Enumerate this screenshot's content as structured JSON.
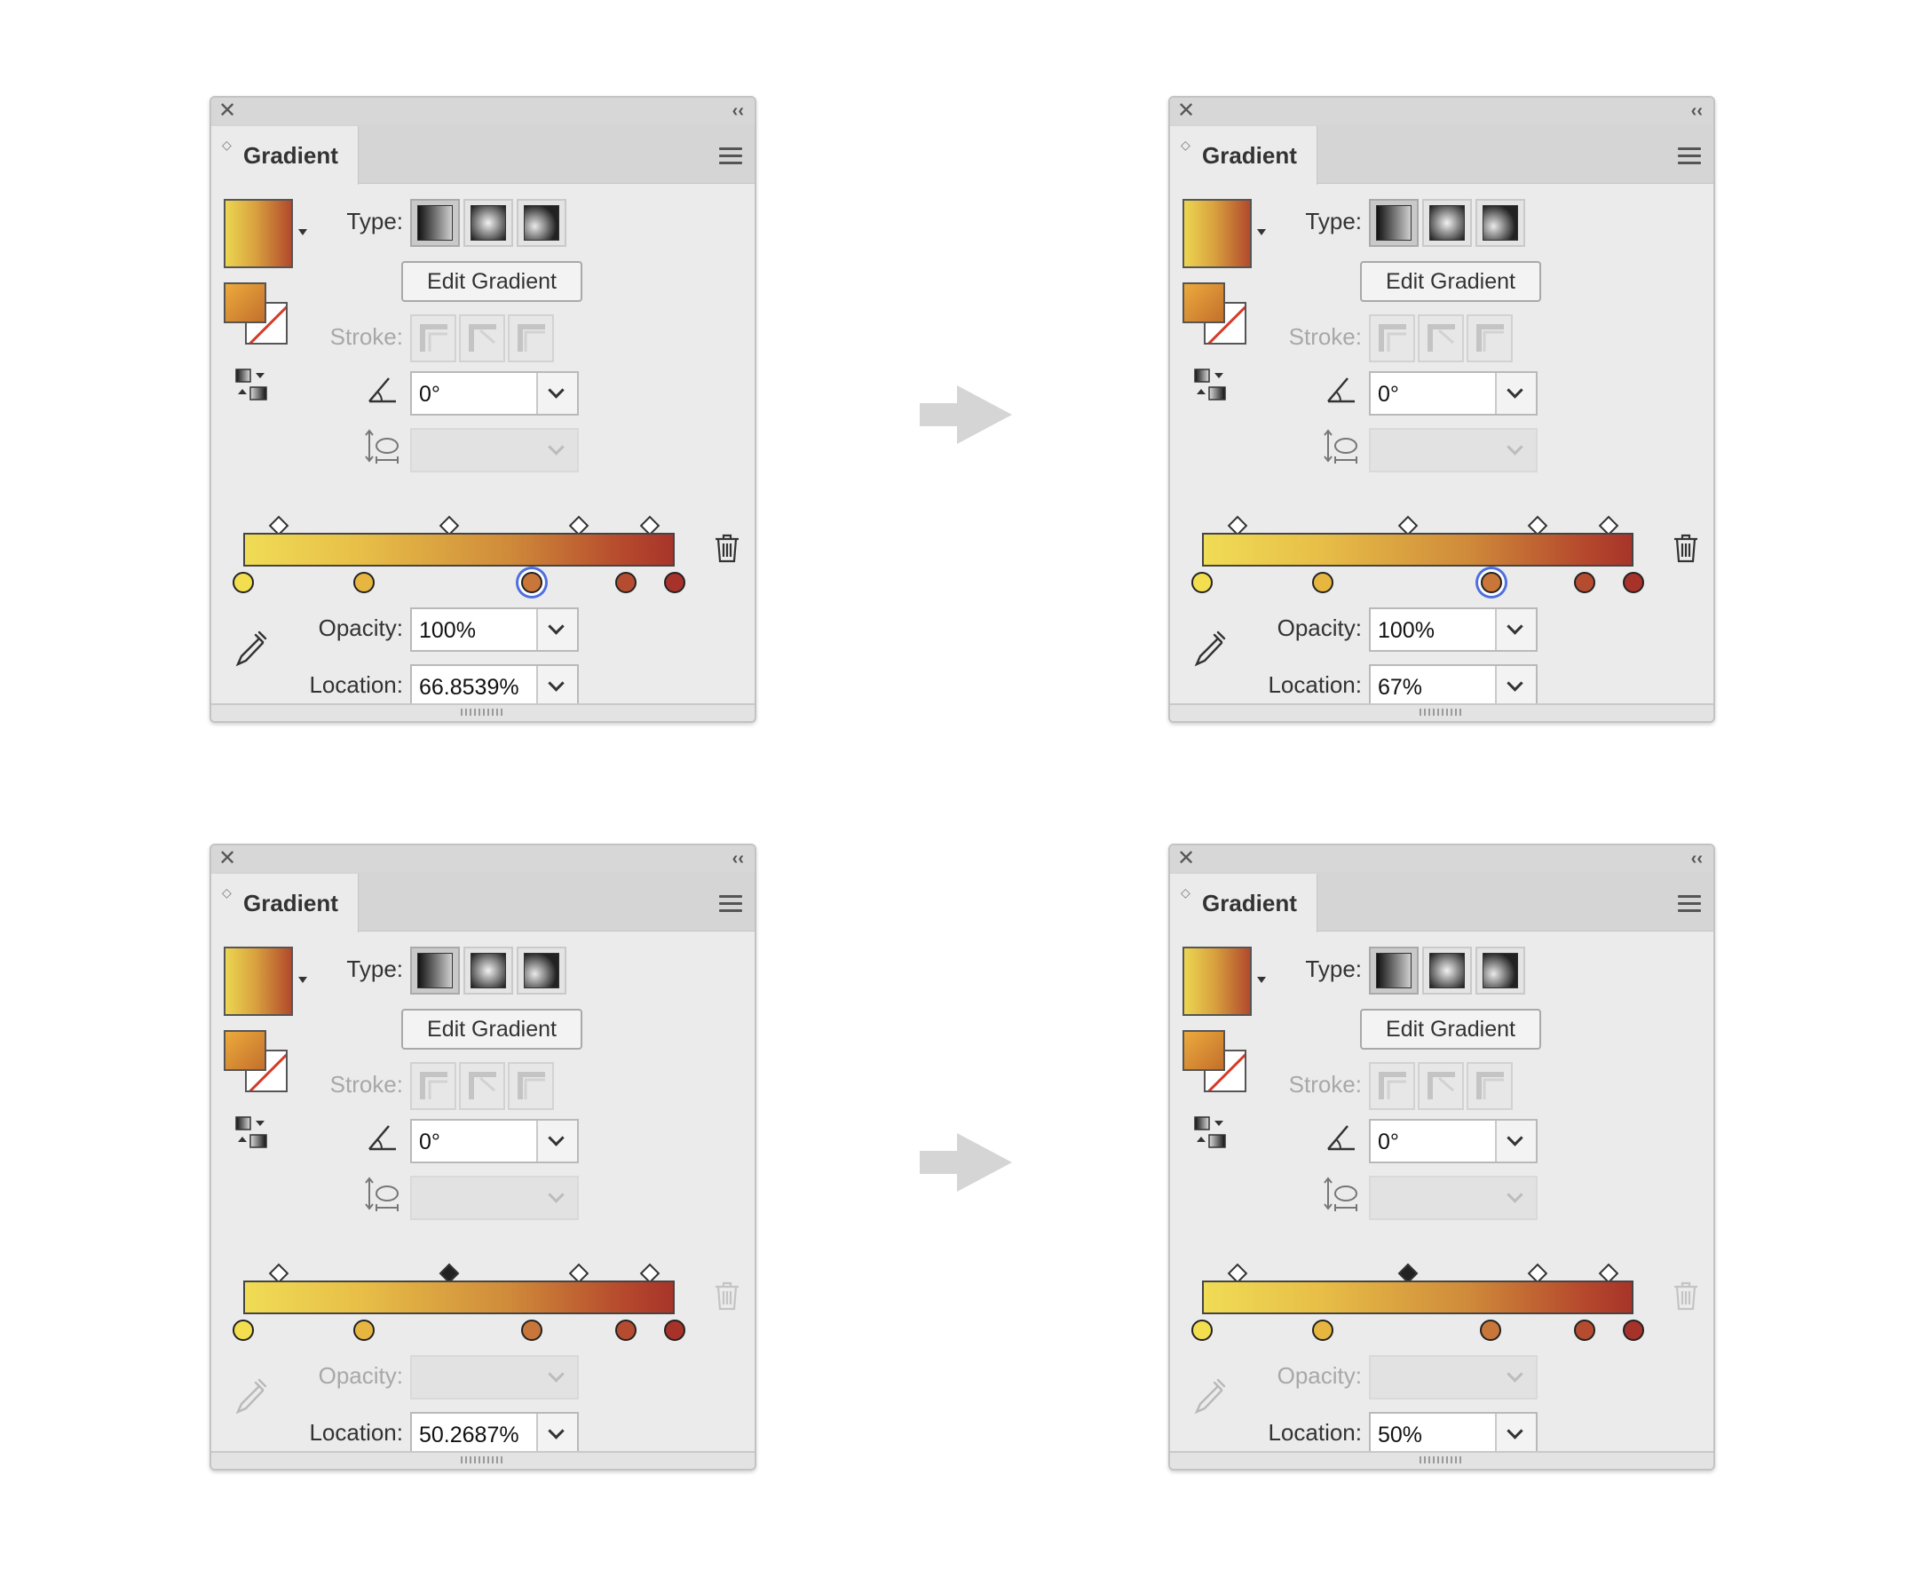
{
  "colors": {
    "panel_bg": "#ebebeb",
    "selection_ring": "#4d6fe0",
    "arrow": "#d5d5d5"
  },
  "gradient": {
    "css": "linear-gradient(90deg, #f0dc55 0%, #e7bd47 28%, #cf8a3a 62%, #b64a2d 88%, #a8342a 100%)"
  },
  "panels": [
    {
      "close_glyph": "✕",
      "collapse_glyph": "‹‹",
      "tab_label": "Gradient",
      "type_label": "Type:",
      "edit_gradient_label": "Edit Gradient",
      "stroke_label": "Stroke:",
      "angle_value": "0°",
      "opacity_label": "Opacity:",
      "opacity_value": "100%",
      "opacity_enabled": true,
      "location_label": "Location:",
      "location_value": "66.8539%",
      "trash_enabled": true,
      "midpoints": [
        {
          "position": 8
        },
        {
          "position": 47.5
        },
        {
          "position": 77.5
        },
        {
          "position": 94
        }
      ],
      "selected_midpoint": -1,
      "stops": [
        {
          "position": 0,
          "color": "#f2de4f"
        },
        {
          "position": 28,
          "color": "#e6b640"
        },
        {
          "position": 66.85,
          "color": "#c9763a"
        },
        {
          "position": 88.7,
          "color": "#b64c2f"
        },
        {
          "position": 100,
          "color": "#a6322a"
        }
      ],
      "selected_stop": 2
    },
    {
      "close_glyph": "✕",
      "collapse_glyph": "‹‹",
      "tab_label": "Gradient",
      "type_label": "Type:",
      "edit_gradient_label": "Edit Gradient",
      "stroke_label": "Stroke:",
      "angle_value": "0°",
      "opacity_label": "Opacity:",
      "opacity_value": "100%",
      "opacity_enabled": true,
      "location_label": "Location:",
      "location_value": "67%",
      "trash_enabled": true,
      "midpoints": [
        {
          "position": 8
        },
        {
          "position": 47.5
        },
        {
          "position": 77.5
        },
        {
          "position": 94
        }
      ],
      "selected_midpoint": -1,
      "stops": [
        {
          "position": 0,
          "color": "#f2de4f"
        },
        {
          "position": 28,
          "color": "#e6b640"
        },
        {
          "position": 67,
          "color": "#c9763a"
        },
        {
          "position": 88.7,
          "color": "#b64c2f"
        },
        {
          "position": 100,
          "color": "#a6322a"
        }
      ],
      "selected_stop": 2
    },
    {
      "close_glyph": "✕",
      "collapse_glyph": "‹‹",
      "tab_label": "Gradient",
      "type_label": "Type:",
      "edit_gradient_label": "Edit Gradient",
      "stroke_label": "Stroke:",
      "angle_value": "0°",
      "opacity_label": "Opacity:",
      "opacity_value": "",
      "opacity_enabled": false,
      "location_label": "Location:",
      "location_value": "50.2687%",
      "trash_enabled": false,
      "midpoints": [
        {
          "position": 8
        },
        {
          "position": 47.5
        },
        {
          "position": 77.5
        },
        {
          "position": 94
        }
      ],
      "selected_midpoint": 1,
      "stops": [
        {
          "position": 0,
          "color": "#f2de4f"
        },
        {
          "position": 28,
          "color": "#e6b640"
        },
        {
          "position": 66.85,
          "color": "#c9763a"
        },
        {
          "position": 88.7,
          "color": "#b64c2f"
        },
        {
          "position": 100,
          "color": "#a6322a"
        }
      ],
      "selected_stop": -1
    },
    {
      "close_glyph": "✕",
      "collapse_glyph": "‹‹",
      "tab_label": "Gradient",
      "type_label": "Type:",
      "edit_gradient_label": "Edit Gradient",
      "stroke_label": "Stroke:",
      "angle_value": "0°",
      "opacity_label": "Opacity:",
      "opacity_value": "",
      "opacity_enabled": false,
      "location_label": "Location:",
      "location_value": "50%",
      "trash_enabled": false,
      "midpoints": [
        {
          "position": 8
        },
        {
          "position": 47.5
        },
        {
          "position": 77.5
        },
        {
          "position": 94
        }
      ],
      "selected_midpoint": 1,
      "stops": [
        {
          "position": 0,
          "color": "#f2de4f"
        },
        {
          "position": 28,
          "color": "#e6b640"
        },
        {
          "position": 66.85,
          "color": "#c9763a"
        },
        {
          "position": 88.7,
          "color": "#b64c2f"
        },
        {
          "position": 100,
          "color": "#a6322a"
        }
      ],
      "selected_stop": -1
    }
  ]
}
